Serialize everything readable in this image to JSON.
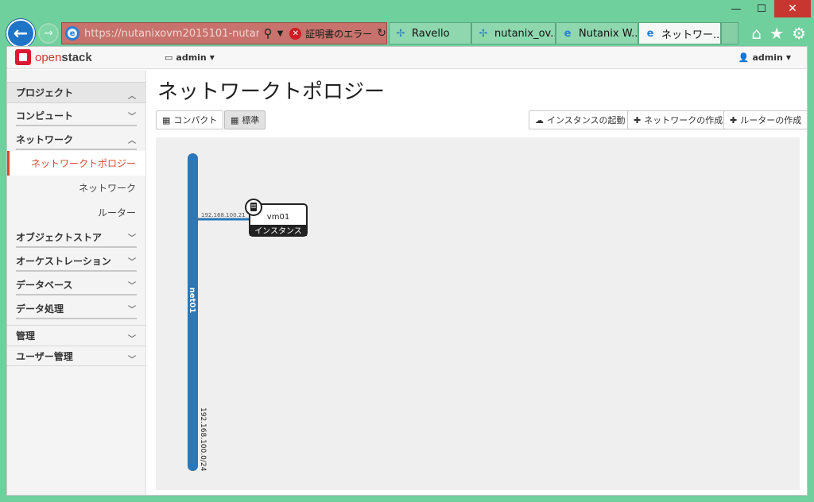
{
  "window": {
    "minimize": "—",
    "maximize": "☐",
    "close": "✕"
  },
  "browser": {
    "url": "https://nutanixovm2015101-nutan...",
    "cert_error": "証明書のエラー",
    "tabs": [
      {
        "label": "Ravello",
        "icon": "pinwheel-icon"
      },
      {
        "label": "nutanix_ov...",
        "icon": "pinwheel-icon"
      },
      {
        "label": "Nutanix W...",
        "icon": "ie-icon"
      },
      {
        "label": "ネットワー...",
        "icon": "ie-icon",
        "active": true
      }
    ]
  },
  "topnav": {
    "brand_a": "open",
    "brand_b": "stack",
    "project": "admin",
    "user": "admin"
  },
  "sidebar": {
    "project_header": "プロジェクト",
    "compute": "コンピュート",
    "network": "ネットワーク",
    "network_topology": "ネットワークトポロジー",
    "networks": "ネットワーク",
    "routers": "ルーター",
    "object_store": "オブジェクトストア",
    "orchestration": "オーケストレーション",
    "database": "データベース",
    "data_processing": "データ処理",
    "admin": "管理",
    "identity": "ユーザー管理"
  },
  "main": {
    "title": "ネットワークトポロジー",
    "compact_btn": "コンパクト",
    "normal_btn": "標準",
    "launch_btn": "インスタンスの起動",
    "create_network_btn": "ネットワークの作成",
    "create_router_btn": "ルーターの作成"
  },
  "topology": {
    "network_name": "net01",
    "network_cidr": "192.168.100.0/24",
    "network_color": "#2a77ba",
    "instance_name": "vm01",
    "instance_type": "インスタンス",
    "instance_ip": "192.168.100.21"
  }
}
